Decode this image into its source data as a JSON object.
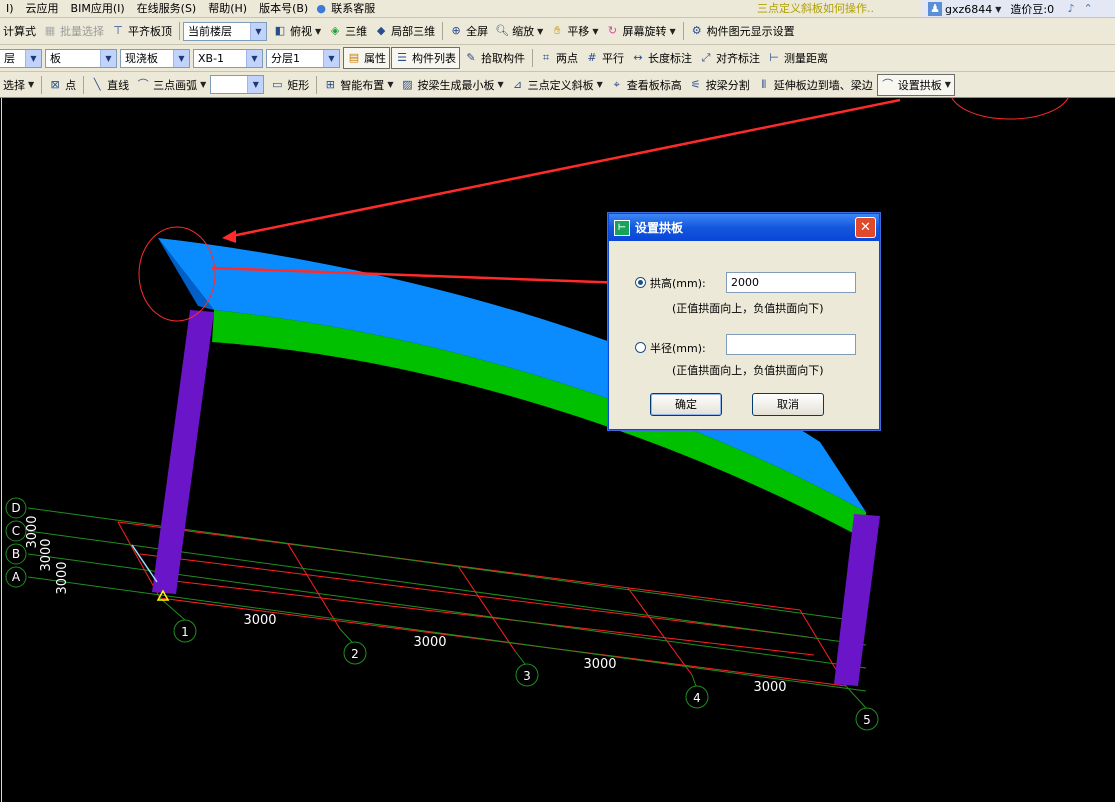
{
  "menubar": {
    "items": [
      "I)",
      "云应用",
      "BIM应用(I)",
      "在线服务(S)",
      "帮助(H)",
      "版本号(B)",
      "联系客服"
    ],
    "notice": "三点定义斜板如何操作..",
    "user": "gxz6844",
    "price_label": "造价豆:0"
  },
  "toolbar1": {
    "calc_formula": "计算式",
    "batch_select": "批量选择",
    "flush_slab_top": "平齐板顶",
    "floor_combo": "当前楼层",
    "view_mode": "俯视",
    "view_3d": "三维",
    "local_3d": "局部三维",
    "fullscreen": "全屏",
    "zoom": "缩放",
    "pan": "平移",
    "rotate": "屏幕旋转",
    "display_settings": "构件图元显示设置"
  },
  "toolbar2": {
    "floor_short": "层",
    "type_combo": "板",
    "subtype_combo": "现浇板",
    "name_combo": "XB-1",
    "layer_combo": "分层1",
    "properties": "属性",
    "component_list": "构件列表",
    "pick": "拾取构件",
    "two_points": "两点",
    "parallel": "平行",
    "length_dim": "长度标注",
    "align_dim": "对齐标注",
    "measure": "测量距离"
  },
  "toolbar3": {
    "select": "选择",
    "point": "点",
    "line": "直线",
    "arc3": "三点画弧",
    "shape_combo": "",
    "rect": "矩形",
    "smart_layout": "智能布置",
    "gen_by_beam": "按梁生成最小板",
    "three_point_slope": "三点定义斜板",
    "view_elevation": "查看板标高",
    "split_by_beam": "按梁分割",
    "extend": "延伸板边到墙、梁边",
    "set_arch": "设置拱板"
  },
  "viewport": {
    "row_axes": [
      "D",
      "C",
      "B",
      "A"
    ],
    "row_spacing": [
      "3000",
      "3000",
      "3000"
    ],
    "col_axes": [
      "1",
      "2",
      "3",
      "4",
      "5"
    ],
    "col_spacing": [
      "3000",
      "3000",
      "3000",
      "3000"
    ],
    "colors": {
      "slab": "#0a8cff",
      "beam": "#00c000",
      "column": "#6a16c8",
      "grid_red": "#ff2020",
      "grid_green": "#1f8f1f",
      "annotation": "#ff2b2b"
    }
  },
  "dialog": {
    "title": "设置拱板",
    "option_rise_label": "拱高(mm):",
    "rise_value": "2000",
    "rise_hint": "(正值拱面向上，负值拱面向下)",
    "option_radius_label": "半径(mm):",
    "radius_value": "",
    "radius_hint": "(正值拱面向上，负值拱面向下)",
    "ok": "确定",
    "cancel": "取消"
  }
}
